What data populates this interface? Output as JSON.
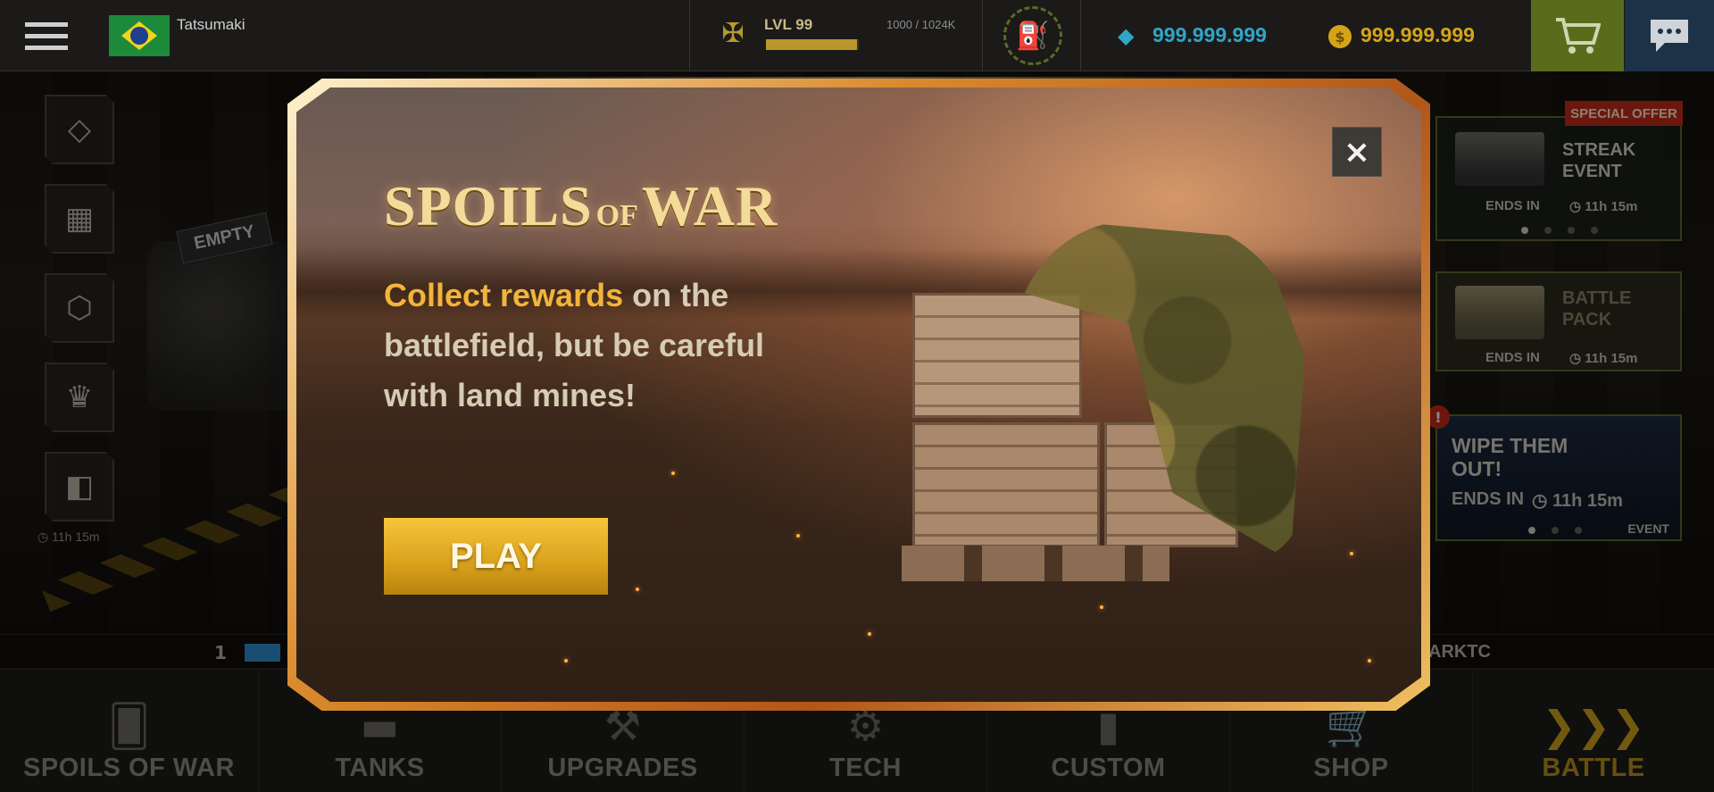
{
  "topbar": {
    "username": "Tatsumaki",
    "level": "LVL 99",
    "xp_text": "1000 / 1024K",
    "xp_fraction": 0.98,
    "gems": "999.999.999",
    "coins": "999.999.999"
  },
  "side": {
    "timer": "11h 15m"
  },
  "background": {
    "garage_tag": "EMPTY",
    "ticker_rank": "1",
    "ticker_player": "ARKTC"
  },
  "promos": [
    {
      "tag": "SPECIAL OFFER",
      "title_line1": "STREAK",
      "title_line2": "EVENT",
      "ends_label": "ENDS IN",
      "time": "11h 15m"
    },
    {
      "title_line1": "BATTLE",
      "title_line2": "PACK",
      "ends_label": "ENDS IN",
      "time": "11h 15m"
    },
    {
      "title_line1": "WIPE THEM",
      "title_line2": "OUT!",
      "ends_label": "ENDS IN",
      "time": "11h 15m",
      "badge": "EVENT"
    }
  ],
  "modal": {
    "title_spoils": "SPOILS",
    "title_of": "OF",
    "title_war": "WAR",
    "desc_highlight": "Collect rewards",
    "desc_rest": " on the battlefield, but  be careful with land mines!",
    "play_label": "PLAY",
    "close_label": "×"
  },
  "nav": {
    "items": [
      {
        "label": "SPOILS OF WAR",
        "icon": "cards-icon"
      },
      {
        "label": "TANKS",
        "icon": "tank-icon"
      },
      {
        "label": "UPGRADES",
        "icon": "wrench-icon"
      },
      {
        "label": "TECH",
        "icon": "tech-icon"
      },
      {
        "label": "CUSTOM",
        "icon": "paint-icon"
      },
      {
        "label": "SHOP",
        "icon": "cart-icon"
      },
      {
        "label": "BATTLE",
        "icon": "chevrons-icon"
      }
    ]
  },
  "colors": {
    "gems": "#2fa6c8",
    "coins": "#d4a418",
    "play_button": "#f5c63c",
    "highlight": "#f2b43a",
    "special_offer": "#c42a1a"
  }
}
